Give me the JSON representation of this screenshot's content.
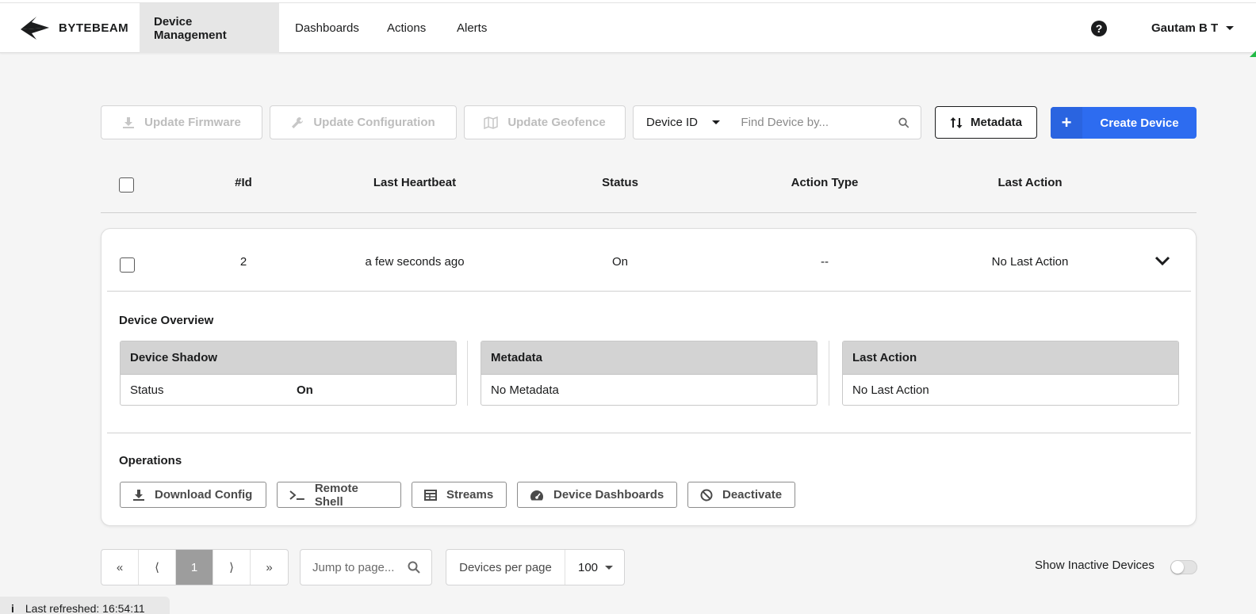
{
  "app": {
    "brand": "BYTEBEAM",
    "accent_color": "#2d6cf0"
  },
  "nav": {
    "items": [
      {
        "label": "Device Management",
        "active": true
      },
      {
        "label": "Dashboards",
        "active": false
      },
      {
        "label": "Actions",
        "active": false
      },
      {
        "label": "Alerts",
        "active": false
      }
    ],
    "help_icon": "question-circle-icon",
    "user_name": "Gautam B T"
  },
  "toolbar": {
    "update_firmware": "Update Firmware",
    "update_configuration": "Update Configuration",
    "update_geofence": "Update Geofence",
    "search_field_selected": "Device ID",
    "search_placeholder": "Find Device by...",
    "metadata_button": "Metadata",
    "create_device_button": "Create Device"
  },
  "table": {
    "columns": [
      "#Id",
      "Last Heartbeat",
      "Status",
      "Action Type",
      "Last Action"
    ],
    "rows": [
      {
        "id": "2",
        "last_heartbeat": "a few seconds ago",
        "status": "On",
        "action_type": "--",
        "last_action": "No Last Action",
        "expanded": true
      }
    ]
  },
  "device_detail": {
    "overview_title": "Device Overview",
    "shadow": {
      "title": "Device Shadow",
      "key": "Status",
      "value": "On"
    },
    "metadata": {
      "title": "Metadata",
      "value": "No Metadata"
    },
    "last_action": {
      "title": "Last Action",
      "value": "No Last Action"
    },
    "operations_title": "Operations",
    "operations": [
      {
        "label": "Download Config",
        "icon": "download-icon"
      },
      {
        "label": "Remote Shell",
        "icon": "terminal-icon"
      },
      {
        "label": "Streams",
        "icon": "table-icon"
      },
      {
        "label": "Device Dashboards",
        "icon": "dashboard-gauge-icon"
      },
      {
        "label": "Deactivate",
        "icon": "ban-icon"
      }
    ]
  },
  "pagination": {
    "first": "«",
    "prev": "⟨",
    "current_page": "1",
    "next": "⟩",
    "last": "»",
    "jump_placeholder": "Jump to page...",
    "per_page_label": "Devices per page",
    "per_page_value": "100",
    "show_inactive_label": "Show Inactive Devices",
    "show_inactive_enabled": false
  },
  "footer": {
    "last_refreshed": "Last refreshed: 16:54:11"
  }
}
